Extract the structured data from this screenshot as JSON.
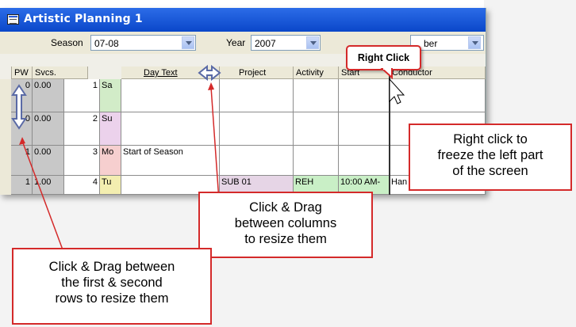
{
  "window": {
    "title": "Artistic Planning  1",
    "season_label": "Season",
    "season_value": "07-08",
    "year_label": "Year",
    "year_value": "2007",
    "third_combo_value": "ber"
  },
  "columns": {
    "pw": "PW",
    "svcs": "Svcs.",
    "day_text": "Day Text",
    "project": "Project",
    "activity": "Activity",
    "start": "Start",
    "conductor": "Conductor"
  },
  "rows": [
    {
      "pw": "0",
      "svcs": "0.00",
      "num": "1",
      "day": "Sa",
      "day_text": "",
      "project": "",
      "activity": "",
      "start": "",
      "conductor": ""
    },
    {
      "pw": "0",
      "svcs": "0.00",
      "num": "2",
      "day": "Su",
      "day_text": "",
      "project": "",
      "activity": "",
      "start": "",
      "conductor": ""
    },
    {
      "pw": "1",
      "svcs": "0.00",
      "num": "3",
      "day": "Mo",
      "day_text": "Start of Season",
      "project": "",
      "activity": "",
      "start": "",
      "conductor": ""
    },
    {
      "pw": "1",
      "svcs": "1.00",
      "num": "4",
      "day": "Tu",
      "day_text": "",
      "project": "SUB 01",
      "activity": "REH",
      "start": "10:00 AM-",
      "conductor": "Han"
    }
  ],
  "callouts": {
    "right_click_bubble": "Right Click",
    "right_click_freeze": [
      "Right click to",
      "freeze the left part",
      "of the screen"
    ],
    "drag_columns": [
      "Click & Drag",
      "between columns",
      "to resize them"
    ],
    "drag_rows": [
      "Click & Drag between",
      "the first & second",
      "rows to resize them"
    ]
  },
  "colors": {
    "callout_border": "#d42a2a",
    "titlebar": "#0a47c9"
  }
}
